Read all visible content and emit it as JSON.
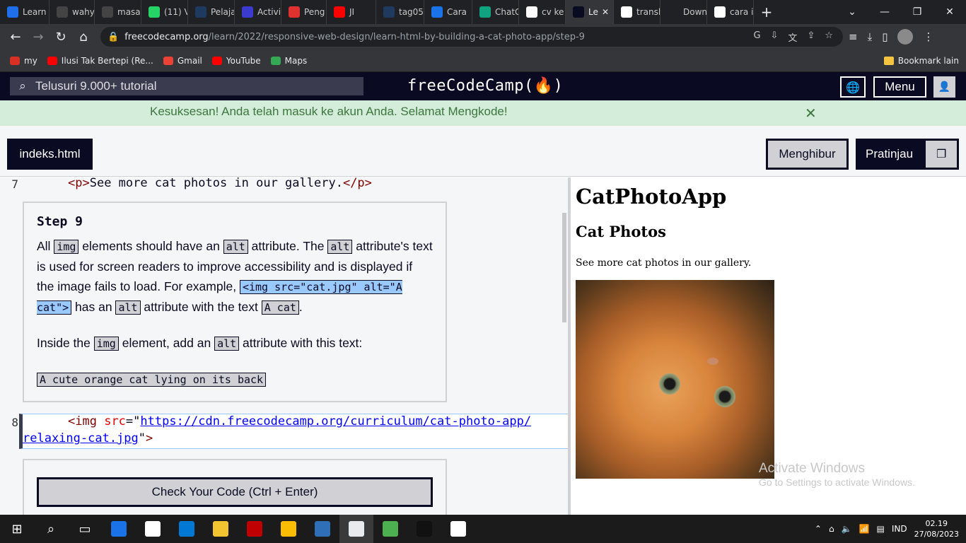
{
  "browser": {
    "tabs": [
      {
        "label": "Learn",
        "color": "#1f6feb",
        "w": 70
      },
      {
        "label": "wahy",
        "color": "#444444",
        "w": 64
      },
      {
        "label": "masa",
        "color": "#444444",
        "w": 66
      },
      {
        "label": "(11) V",
        "color": "#25d366",
        "w": 66
      },
      {
        "label": "Pelaja",
        "color": "#1e3a5f",
        "w": 66
      },
      {
        "label": "Activi",
        "color": "#3b3bd0",
        "w": 66
      },
      {
        "label": "Peng",
        "color": "#e03131",
        "w": 64
      },
      {
        "label": "JI",
        "color": "#ff0000",
        "w": 70
      },
      {
        "label": "tag05",
        "color": "#1e3a5f",
        "w": 68
      },
      {
        "label": "Cara",
        "color": "#1a73e8",
        "w": 68
      },
      {
        "label": "ChatG",
        "color": "#10a37f",
        "w": 66
      },
      {
        "label": "cv ke",
        "color": "#ffffff",
        "w": 66
      },
      {
        "label": "Le",
        "color": "#0a0a23",
        "w": 68,
        "active": true
      },
      {
        "label": "transl",
        "color": "#ffffff",
        "w": 66
      },
      {
        "label": "Down",
        "color": "#202124",
        "w": 66
      },
      {
        "label": "cara i",
        "color": "#ffffff",
        "w": 66
      }
    ],
    "new_tab": "+",
    "window_controls": [
      "⌄",
      "—",
      "❐",
      "✕"
    ],
    "url_host": "freecodecamp.org",
    "url_path": "/learn/2022/responsive-web-design/learn-html-by-building-a-cat-photo-app/step-9",
    "bookmarks": [
      {
        "label": "my",
        "color": "#d93025"
      },
      {
        "label": "Ilusi Tak Bertepi (Re...",
        "color": "#ff0000"
      },
      {
        "label": "Gmail",
        "color": "#ea4335"
      },
      {
        "label": "YouTube",
        "color": "#ff0000"
      },
      {
        "label": "Maps",
        "color": "#34a853"
      }
    ],
    "other_bookmarks": "Bookmark lain"
  },
  "fcc": {
    "search_placeholder": "Telusuri 9.000+ tutorial",
    "logo": "freeCodeCamp(🔥)",
    "menu_label": "Menu",
    "flash_message": "Kesuksesan! Anda telah masuk ke akun Anda. Selamat Mengkode!",
    "flash_close": "✕",
    "file_tab": "indeks.html",
    "console_btn": "Menghibur",
    "preview_btn": "Pratinjau"
  },
  "editor": {
    "line7_no": "7",
    "line8_no": "8",
    "step_title": "Step 9",
    "check_button": "Check Your Code (Ctrl + Enter)"
  },
  "preview": {
    "h1": "CatPhotoApp",
    "h2": "Cat Photos",
    "p": "See more cat photos in our gallery."
  },
  "watermark": {
    "line1": "Activate Windows",
    "line2": "Go to Settings to activate Windows."
  },
  "taskbar": {
    "apps": [
      {
        "name": "start-icon",
        "glyph": "⊞",
        "color": ""
      },
      {
        "name": "search-icon",
        "glyph": "⌕",
        "color": ""
      },
      {
        "name": "task-view-icon",
        "glyph": "▭",
        "color": ""
      },
      {
        "name": "edge-icon",
        "glyph": "",
        "color": "#1a73e8"
      },
      {
        "name": "store-icon",
        "glyph": "",
        "color": "#ffffff"
      },
      {
        "name": "vscode-icon",
        "glyph": "",
        "color": "#0078d4"
      },
      {
        "name": "explorer-icon",
        "glyph": "",
        "color": "#f4c430"
      },
      {
        "name": "flash-icon",
        "glyph": "",
        "color": "#c00000"
      },
      {
        "name": "chrome-icon",
        "glyph": "",
        "color": "#fbbc04"
      },
      {
        "name": "photoshop-icon",
        "glyph": "",
        "color": "#2f6fb8"
      },
      {
        "name": "chrome-active-icon",
        "glyph": "",
        "color": "#e8eaed",
        "active": true
      },
      {
        "name": "notepad-icon",
        "glyph": "",
        "color": "#4caf50"
      },
      {
        "name": "terminal-icon",
        "glyph": "",
        "color": "#111111"
      },
      {
        "name": "photos-icon",
        "glyph": "",
        "color": "#ffffff"
      }
    ],
    "lang": "IND",
    "time": "02.19",
    "date": "27/08/2023"
  },
  "colors": {
    "fcc_dark": "#0a0a23",
    "flash_bg": "#d4edda",
    "flash_text": "#3c763d",
    "code_highlight": "#99c9ff"
  }
}
